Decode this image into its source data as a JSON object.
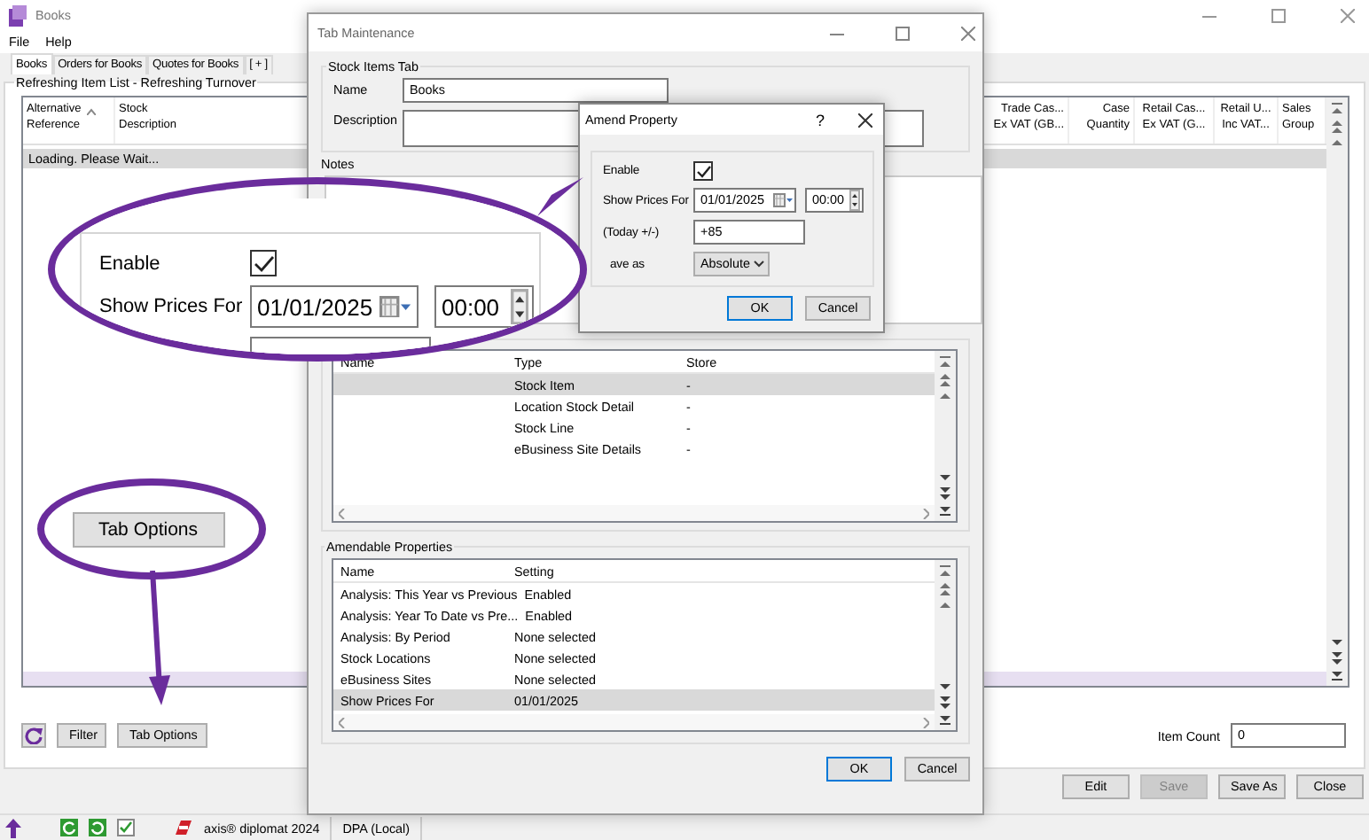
{
  "window": {
    "title": "Books"
  },
  "menu": [
    "File",
    "Help"
  ],
  "tabs": [
    {
      "label": "Books",
      "selected": true
    },
    {
      "label": "Orders for Books",
      "selected": false
    },
    {
      "label": "Quotes for Books",
      "selected": false
    },
    {
      "label": "[ + ]",
      "selected": false
    }
  ],
  "item_list": {
    "title": "Refreshing Item List - Refreshing Turnover",
    "columns": [
      {
        "label": "Alternative\nReference",
        "sorted": true
      },
      {
        "label": "Stock\nDescription",
        "sorted": false
      },
      {
        "label": "Trade Cas...\nEx VAT (GB...",
        "sorted": false
      },
      {
        "label": "Case\nQuantity",
        "sorted": false
      },
      {
        "label": "Retail Cas...\nEx VAT (G...",
        "sorted": false
      },
      {
        "label": "Retail U...\nInc VAT...",
        "sorted": false
      },
      {
        "label": "Sales\nGroup",
        "sorted": false
      }
    ],
    "status_row": "Loading. Please Wait..."
  },
  "list_buttons": [
    "Filter",
    "Tab Options"
  ],
  "item_count": {
    "label": "Item Count",
    "value": "0"
  },
  "actions": [
    {
      "label": "Edit",
      "disabled": false
    },
    {
      "label": "Save",
      "disabled": true
    },
    {
      "label": "Save As",
      "disabled": false
    },
    {
      "label": "Close",
      "disabled": false
    }
  ],
  "status_bar": {
    "product": "axis® diplomat 2024",
    "connection": "DPA (Local)"
  },
  "tab_maintenance": {
    "title": "Tab Maintenance",
    "group_title": "Stock Items Tab",
    "name_label": "Name",
    "name_value": "Books",
    "description_label": "Description",
    "notes_label": "Notes",
    "stores": {
      "columns": [
        "Name",
        "Type",
        "Store"
      ],
      "rows": [
        {
          "type": "Stock Item",
          "store": "-",
          "selected": true
        },
        {
          "type": "Location Stock Detail",
          "store": "-",
          "selected": false
        },
        {
          "type": "Stock Line",
          "store": "-",
          "selected": false
        },
        {
          "type": "eBusiness Site Details",
          "store": "-",
          "selected": false
        }
      ]
    },
    "properties": {
      "title": "Amendable Properties",
      "columns": [
        "Name",
        "Setting"
      ],
      "rows": [
        {
          "name": "Analysis: This Year vs Previous",
          "setting": "Enabled",
          "selected": false
        },
        {
          "name": "Analysis: Year To Date vs Pre...",
          "setting": "Enabled",
          "selected": false
        },
        {
          "name": "Analysis: By Period",
          "setting": "None selected",
          "selected": false
        },
        {
          "name": "Stock Locations",
          "setting": "None selected",
          "selected": false
        },
        {
          "name": "eBusiness Sites",
          "setting": "None selected",
          "selected": false
        },
        {
          "name": "Show Prices For",
          "setting": "01/01/2025",
          "selected": true
        }
      ]
    },
    "buttons": [
      "OK",
      "Cancel"
    ]
  },
  "amend_property": {
    "title": "Amend Property",
    "help": "?",
    "enable_label": "Enable",
    "enabled": true,
    "show_prices_label": "Show Prices For",
    "date": "01/01/2025",
    "time": "00:00",
    "offset_label": "(Today +/-)",
    "offset": "+85",
    "save_as_label": "ave as",
    "save_as": "Absolute",
    "buttons": [
      "OK",
      "Cancel"
    ]
  },
  "callout": {
    "enable_label": "Enable",
    "enabled": true,
    "show_prices_label": "Show Prices For",
    "date": "01/01/2025",
    "time": "00:00",
    "button": "Tab Options"
  }
}
